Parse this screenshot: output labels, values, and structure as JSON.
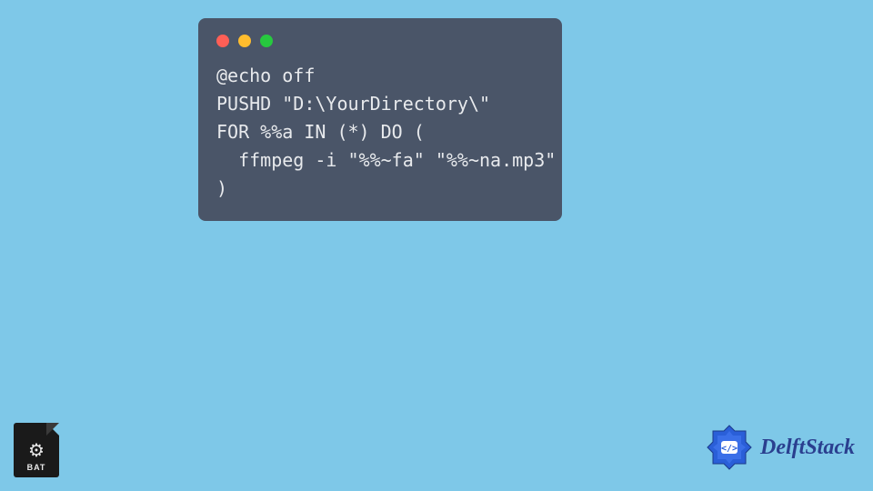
{
  "code": {
    "lines": [
      "@echo off",
      "PUSHD \"D:\\YourDirectory\\\"",
      "FOR %%a IN (*) DO (",
      "  ffmpeg -i \"%%~fa\" \"%%~na.mp3\"",
      ")"
    ]
  },
  "bat_icon": {
    "label": "BAT"
  },
  "logo": {
    "text": "DelftStack"
  },
  "colors": {
    "background": "#7ec8e8",
    "window": "#4a5568",
    "code_text": "#e8eaed",
    "logo_primary": "#2a3f8f"
  }
}
